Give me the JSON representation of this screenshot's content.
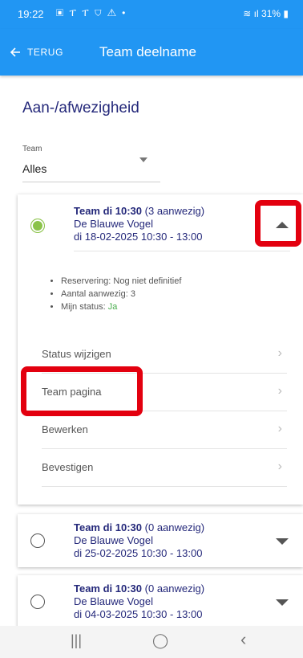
{
  "status_bar": {
    "time": "19:22",
    "notifications": "▣ ፐ ፐ ⛉ ⚠ •",
    "battery": "31%"
  },
  "app_bar": {
    "back_label": "TERUG",
    "title": "Team deelname"
  },
  "page": {
    "title": "Aan-/afwezigheid"
  },
  "filter": {
    "label": "Team",
    "value": "Alles"
  },
  "cards": [
    {
      "team": "Team di 10:30",
      "count": "(3 aanwezig)",
      "location": "De Blauwe Vogel",
      "date": "di 18-02-2025 10:30 - 13:00",
      "selected": true,
      "expanded": true,
      "details": {
        "reservation": "Reservering: Nog niet definitief",
        "attendees": "Aantal aanwezig: 3",
        "my_status_label": "Mijn status:",
        "my_status_value": "Ja"
      },
      "actions": [
        "Status wijzigen",
        "Team pagina",
        "Bewerken",
        "Bevestigen"
      ]
    },
    {
      "team": "Team di 10:30",
      "count": "(0 aanwezig)",
      "location": "De Blauwe Vogel",
      "date": "di 25-02-2025 10:30 - 13:00",
      "selected": false,
      "expanded": false
    },
    {
      "team": "Team di 10:30",
      "count": "(0 aanwezig)",
      "location": "De Blauwe Vogel",
      "date": "di 04-03-2025 10:30 - 13:00",
      "selected": false,
      "expanded": false
    }
  ],
  "colors": {
    "primary": "#2196f3",
    "title_text": "#24287a",
    "highlight": "#e3000f",
    "active_radio": "#8bc34a"
  },
  "nav": {
    "recents": "|||",
    "home": "◯",
    "back": "‹"
  }
}
